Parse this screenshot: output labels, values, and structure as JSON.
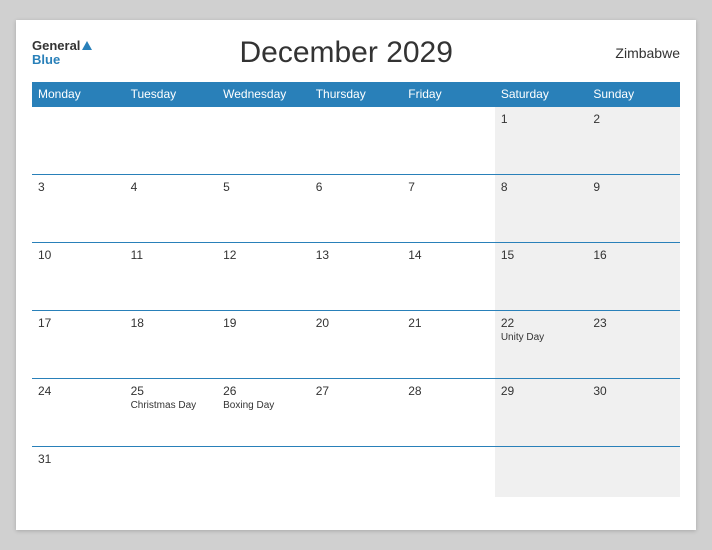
{
  "header": {
    "logo_general": "General",
    "logo_blue": "Blue",
    "title": "December 2029",
    "country": "Zimbabwe"
  },
  "weekdays": [
    "Monday",
    "Tuesday",
    "Wednesday",
    "Thursday",
    "Friday",
    "Saturday",
    "Sunday"
  ],
  "weeks": [
    [
      {
        "day": "",
        "weekend": false
      },
      {
        "day": "",
        "weekend": false
      },
      {
        "day": "",
        "weekend": false
      },
      {
        "day": "",
        "weekend": false
      },
      {
        "day": "",
        "weekend": false
      },
      {
        "day": "1",
        "weekend": true
      },
      {
        "day": "2",
        "weekend": true
      }
    ],
    [
      {
        "day": "3",
        "weekend": false
      },
      {
        "day": "4",
        "weekend": false
      },
      {
        "day": "5",
        "weekend": false
      },
      {
        "day": "6",
        "weekend": false
      },
      {
        "day": "7",
        "weekend": false
      },
      {
        "day": "8",
        "weekend": true
      },
      {
        "day": "9",
        "weekend": true
      }
    ],
    [
      {
        "day": "10",
        "weekend": false
      },
      {
        "day": "11",
        "weekend": false
      },
      {
        "day": "12",
        "weekend": false
      },
      {
        "day": "13",
        "weekend": false
      },
      {
        "day": "14",
        "weekend": false
      },
      {
        "day": "15",
        "weekend": true
      },
      {
        "day": "16",
        "weekend": true
      }
    ],
    [
      {
        "day": "17",
        "weekend": false
      },
      {
        "day": "18",
        "weekend": false
      },
      {
        "day": "19",
        "weekend": false
      },
      {
        "day": "20",
        "weekend": false
      },
      {
        "day": "21",
        "weekend": false
      },
      {
        "day": "22",
        "event": "Unity Day",
        "weekend": true
      },
      {
        "day": "23",
        "weekend": true
      }
    ],
    [
      {
        "day": "24",
        "weekend": false
      },
      {
        "day": "25",
        "event": "Christmas Day",
        "weekend": false
      },
      {
        "day": "26",
        "event": "Boxing Day",
        "weekend": false
      },
      {
        "day": "27",
        "weekend": false
      },
      {
        "day": "28",
        "weekend": false
      },
      {
        "day": "29",
        "weekend": true
      },
      {
        "day": "30",
        "weekend": true
      }
    ],
    [
      {
        "day": "31",
        "weekend": false
      },
      {
        "day": "",
        "weekend": false
      },
      {
        "day": "",
        "weekend": false
      },
      {
        "day": "",
        "weekend": false
      },
      {
        "day": "",
        "weekend": false
      },
      {
        "day": "",
        "weekend": true
      },
      {
        "day": "",
        "weekend": true
      }
    ]
  ]
}
